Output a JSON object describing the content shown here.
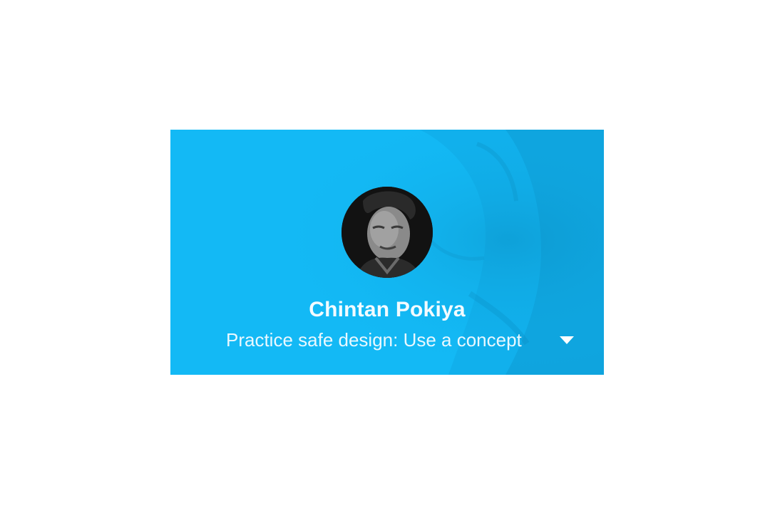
{
  "profile": {
    "name": "Chintan Pokiya",
    "status": "Practice safe design: Use a concept"
  },
  "icons": {
    "dropdown": "chevron-down-icon",
    "avatar": "avatar-photo"
  },
  "colors": {
    "header_background": "#13b9f5",
    "text": "#f2fbff"
  }
}
